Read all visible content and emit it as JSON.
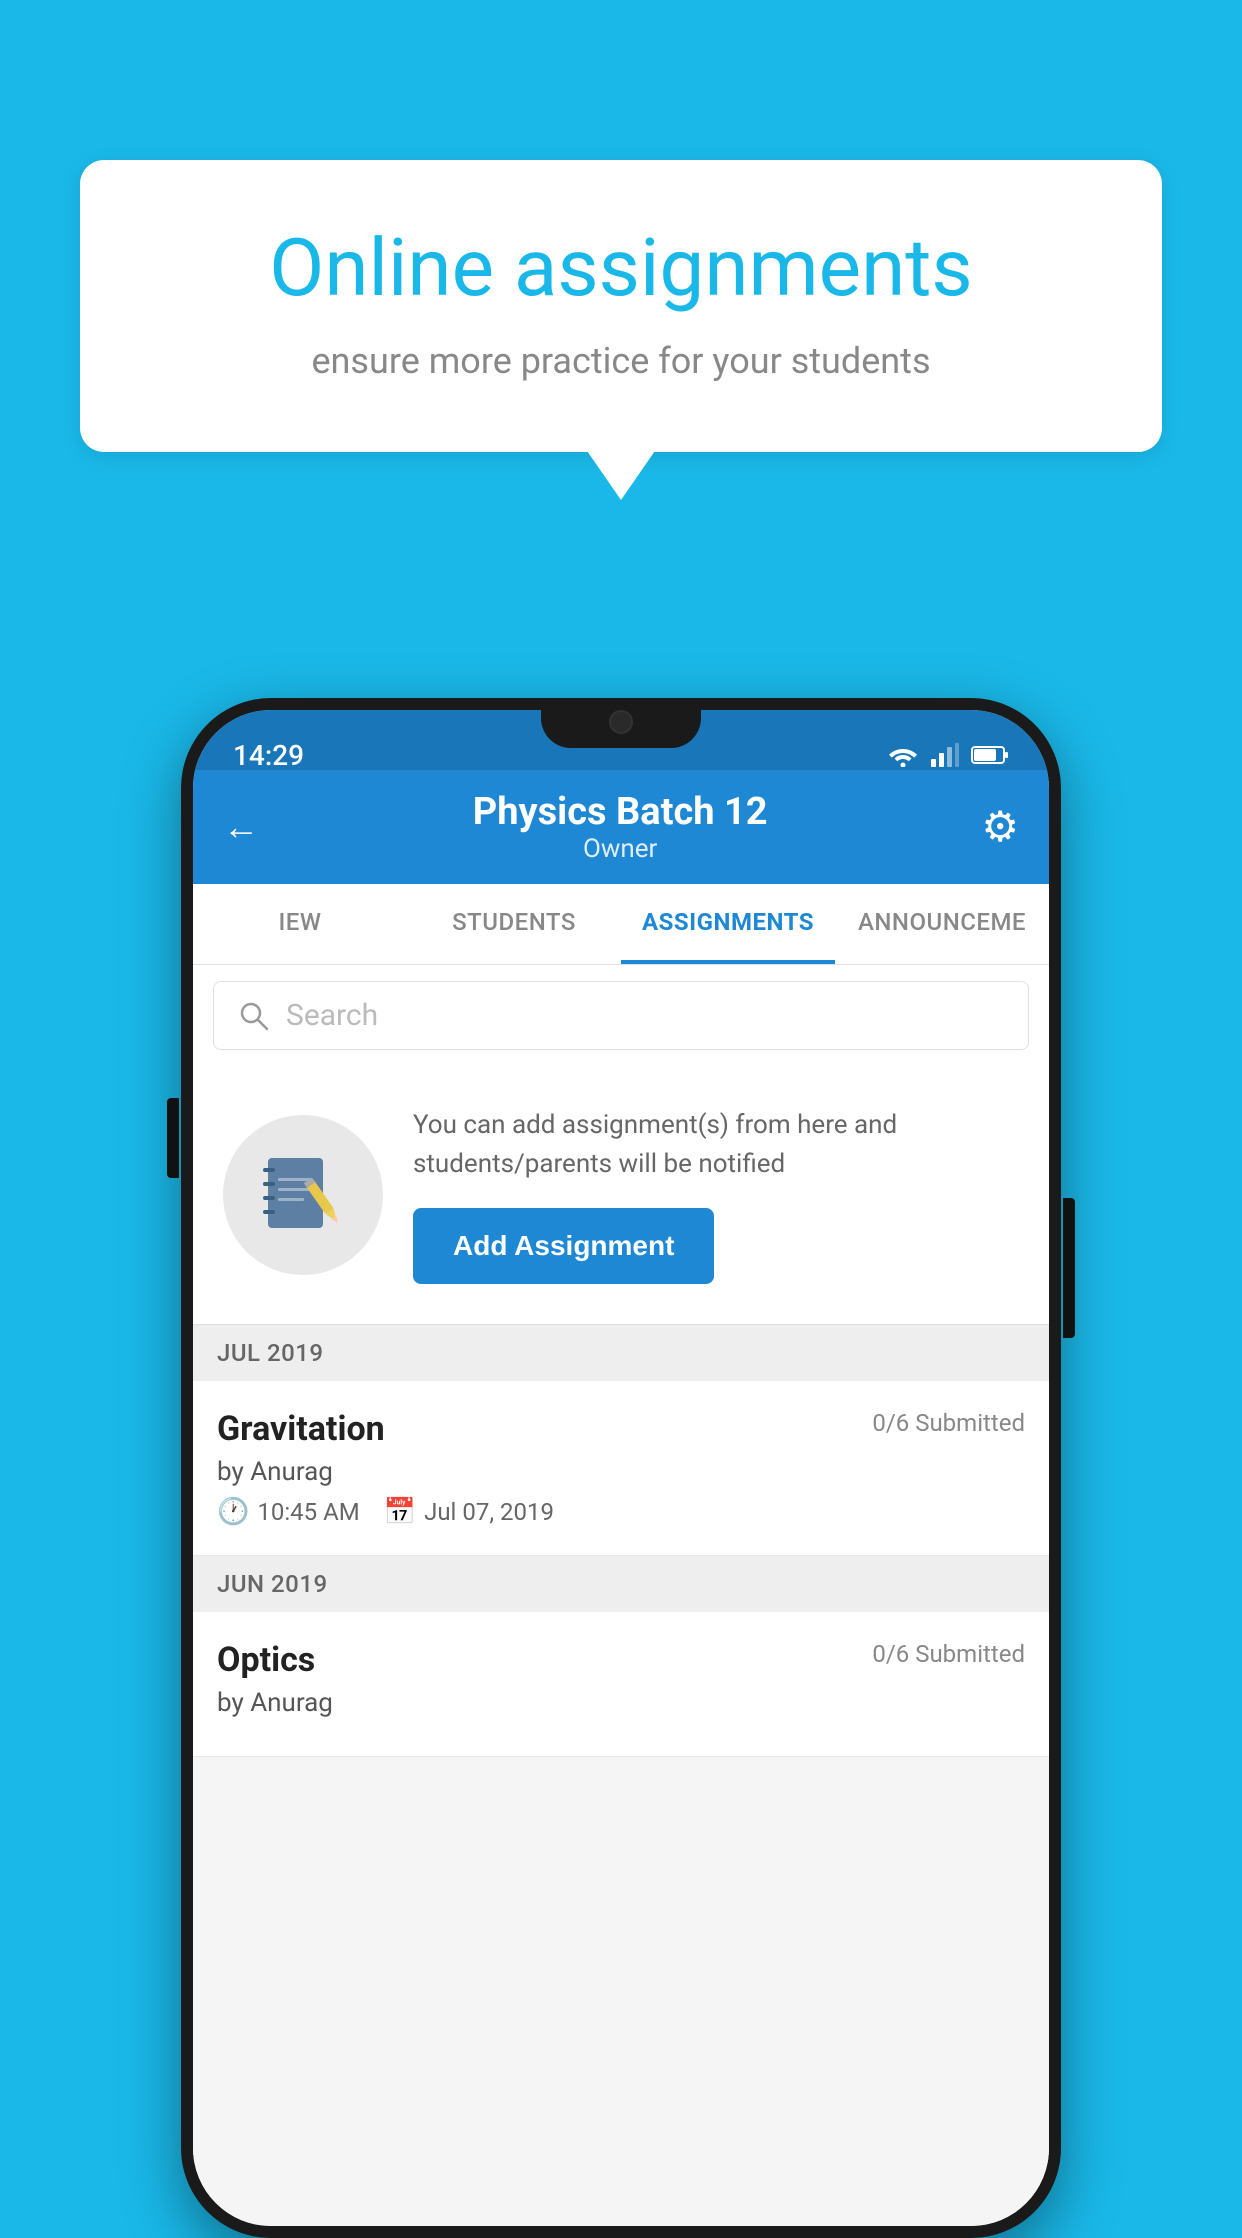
{
  "background": {
    "color": "#1ab8e8"
  },
  "speech_bubble": {
    "title": "Online assignments",
    "subtitle": "ensure more practice for your students"
  },
  "status_bar": {
    "time": "14:29",
    "wifi": "▼",
    "signal": "▲",
    "battery": "70"
  },
  "header": {
    "title": "Physics Batch 12",
    "subtitle": "Owner",
    "back_label": "←",
    "gear_label": "⚙"
  },
  "tabs": [
    {
      "label": "IEW",
      "active": false
    },
    {
      "label": "STUDENTS",
      "active": false
    },
    {
      "label": "ASSIGNMENTS",
      "active": true
    },
    {
      "label": "ANNOUNCEME",
      "active": false
    }
  ],
  "search": {
    "placeholder": "Search"
  },
  "empty_state": {
    "description": "You can add assignment(s) from here and students/parents will be notified",
    "button_label": "Add Assignment"
  },
  "sections": [
    {
      "label": "JUL 2019",
      "assignments": [
        {
          "title": "Gravitation",
          "submitted": "0/6 Submitted",
          "by": "by Anurag",
          "time": "10:45 AM",
          "date": "Jul 07, 2019"
        }
      ]
    },
    {
      "label": "JUN 2019",
      "assignments": [
        {
          "title": "Optics",
          "submitted": "0/6 Submitted",
          "by": "by Anurag",
          "time": "",
          "date": ""
        }
      ]
    }
  ]
}
